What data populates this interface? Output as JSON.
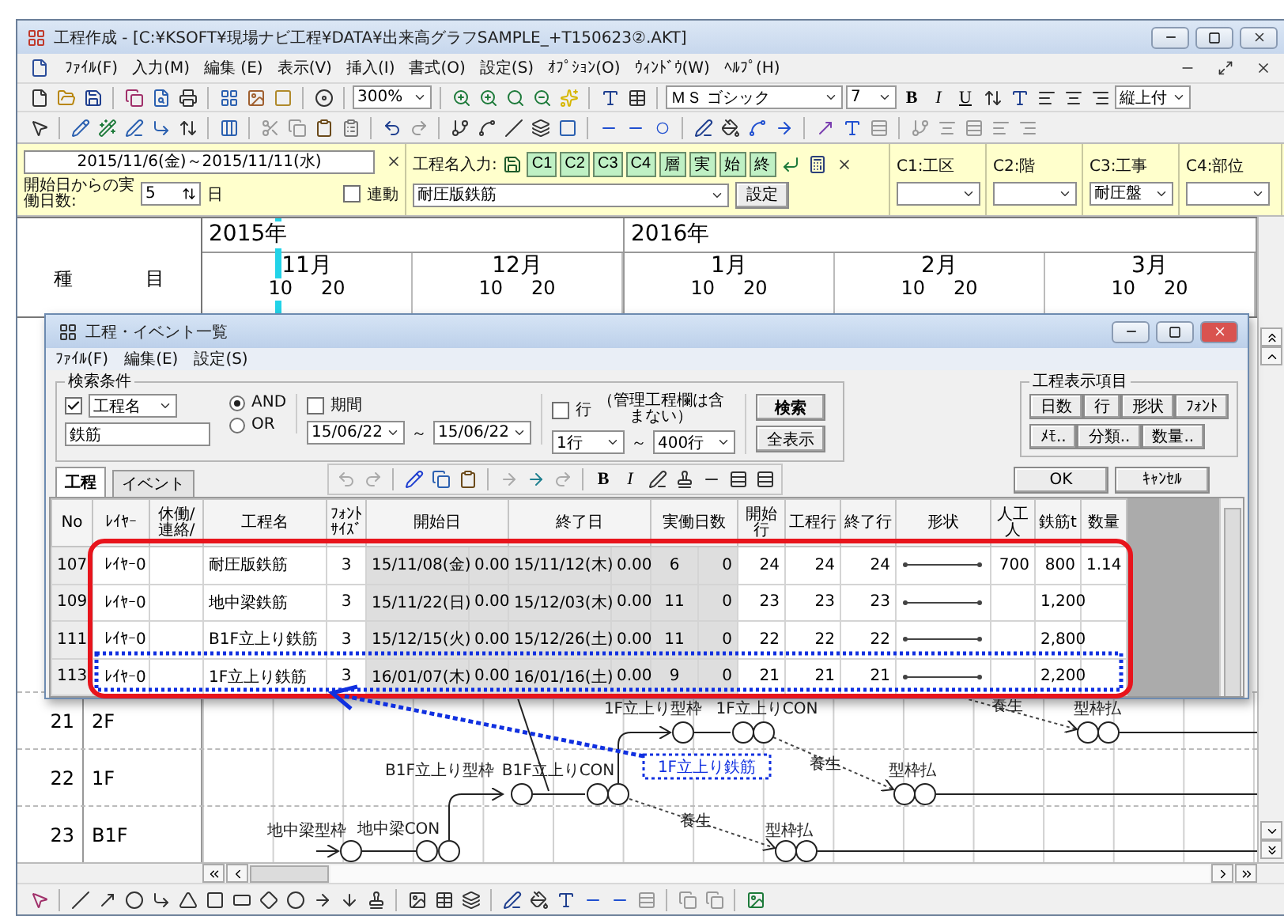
{
  "window": {
    "title": "工程作成 - [C:¥KSOFT¥現場ナビ工程¥DATA¥出来高グラフSAMPLE_+T150623②.AKT]"
  },
  "menu": [
    "ﾌｧｲﾙ(F)",
    "入力(M)",
    "編集 (E)",
    "表示(V)",
    "挿入(I)",
    "書式(O)",
    "設定(S)",
    "ｵﾌﾟｼｮﾝ(O)",
    "ｳｨﾝﾄﾞｳ(W)",
    "ﾍﾙﾌﾟ(H)"
  ],
  "toolbar": {
    "zoom": "300%",
    "font": "ＭＳ ゴシック",
    "font_size": "7",
    "style_buttons": [
      "B",
      "I",
      "U"
    ],
    "text_position": "縦上付"
  },
  "input_bar": {
    "date_range": "2015/11/6(金)～2015/11/11(水)",
    "workdays_label": "開始日からの実働日数:",
    "workdays": "5",
    "workdays_unit": "日",
    "link": {
      "label": "連動",
      "checked": false
    },
    "name_label": "工程名入力:",
    "name_buttons": [
      "C1",
      "C2",
      "C3",
      "C4",
      "層",
      "実",
      "始",
      "終"
    ],
    "name": "耐圧版鉄筋",
    "set_button": "設定",
    "categories": [
      {
        "label": "C1:工区"
      },
      {
        "label": "C2:階"
      },
      {
        "label": "C3:工事",
        "value": "耐圧盤"
      },
      {
        "label": "C4:部位"
      }
    ]
  },
  "chart": {
    "heading": [
      "種",
      "目"
    ],
    "years": [
      {
        "label": "2015年",
        "months": [
          {
            "label": "11月",
            "days": [
              "10",
              "20"
            ]
          },
          {
            "label": "12月",
            "days": [
              "10",
              "20"
            ]
          }
        ]
      },
      {
        "label": "2016年",
        "months": [
          {
            "label": "1月",
            "days": [
              "10",
              "20"
            ]
          },
          {
            "label": "2月",
            "days": [
              "10",
              "20"
            ]
          },
          {
            "label": "3月",
            "days": [
              "10",
              "20"
            ]
          }
        ]
      }
    ],
    "rows": [
      {
        "no": "21",
        "name": "2F"
      },
      {
        "no": "22",
        "name": "1F"
      },
      {
        "no": "23",
        "name": "B1F"
      }
    ],
    "network_labels": [
      "1F立上り型枠",
      "1F立上りCON",
      "養生",
      "型枠払",
      "B1F立上り型枠",
      "B1F立上りCON",
      "1F立上り鉄筋",
      "養生",
      "型枠払",
      "地中梁型枠",
      "地中梁CON",
      "養生",
      "型枠払"
    ]
  },
  "dialog": {
    "title": "工程・イベント一覧",
    "menu": [
      "ﾌｧｲﾙ(F)",
      "編集(E)",
      "設定(S)"
    ],
    "search": {
      "legend": "検索条件",
      "field_check": {
        "checked": true
      },
      "field": "工程名",
      "logic": [
        {
          "label": "AND",
          "selected": true
        },
        {
          "label": "OR",
          "selected": false
        }
      ],
      "keyword": "鉄筋",
      "period": {
        "label": "期間",
        "checked": false
      },
      "date_from": "15/06/22",
      "tilde_1": "～",
      "date_to": "15/06/22",
      "row": {
        "label": "行",
        "checked": false
      },
      "row_note": "（管理工程欄は含まない）",
      "row_from": "1行",
      "tilde_2": "～",
      "row_to": "400行",
      "search_button": "検索",
      "show_all_button": "全表示"
    },
    "display": {
      "legend": "工程表示項目",
      "items": [
        "日数",
        "行",
        "形状",
        "ﾌｫﾝﾄ"
      ],
      "more": [
        "ﾒﾓ..",
        "分類..",
        "数量.."
      ]
    },
    "tabs": [
      {
        "label": "工程",
        "selected": true
      },
      {
        "label": "イベント",
        "selected": false
      }
    ],
    "format_buttons": [
      "B",
      "I"
    ],
    "ok": "OK",
    "cancel": "ｷｬﾝｾﾙ",
    "table": {
      "columns": [
        "No",
        "ﾚｲﾔｰ",
        "休働/連絡/",
        "工程名",
        "ﾌｫﾝﾄｻｲｽﾞ",
        "開始日",
        "終了日",
        "実働日数",
        "開始行",
        "工程行",
        "終了行",
        "形状",
        "人工人",
        "鉄筋t",
        "数量"
      ],
      "rows": [
        {
          "no": "107",
          "layer": "ﾚｲﾔｰ0",
          "name": "耐圧版鉄筋",
          "font": "3",
          "start_date": "15/11/08(金)",
          "start_time": "0.00",
          "end_date": "15/11/12(木)",
          "end_time": "0.00",
          "workdays": "6",
          "extra_days": "0",
          "start_row": "24",
          "process_row": "24",
          "end_row": "24",
          "workers": "700",
          "rebar": "800",
          "quantity": "1.14"
        },
        {
          "no": "109",
          "layer": "ﾚｲﾔｰ0",
          "name": "地中梁鉄筋",
          "font": "3",
          "start_date": "15/11/22(日)",
          "start_time": "0.00",
          "end_date": "15/12/03(木)",
          "end_time": "0.00",
          "workdays": "11",
          "extra_days": "0",
          "start_row": "23",
          "process_row": "23",
          "end_row": "23",
          "rebar": "1,200"
        },
        {
          "no": "111",
          "layer": "ﾚｲﾔｰ0",
          "name": "B1F立上り鉄筋",
          "font": "3",
          "start_date": "15/12/15(火)",
          "start_time": "0.00",
          "end_date": "15/12/26(土)",
          "end_time": "0.00",
          "workdays": "11",
          "extra_days": "0",
          "start_row": "22",
          "process_row": "22",
          "end_row": "22",
          "rebar": "2,800"
        },
        {
          "no": "113",
          "layer": "ﾚｲﾔｰ0",
          "name": "1F立上り鉄筋",
          "font": "3",
          "start_date": "16/01/07(木)",
          "start_time": "0.00",
          "end_date": "16/01/16(土)",
          "end_time": "0.00",
          "workdays": "9",
          "extra_days": "0",
          "start_row": "21",
          "process_row": "21",
          "end_row": "21",
          "rebar": "2,200"
        }
      ]
    }
  }
}
